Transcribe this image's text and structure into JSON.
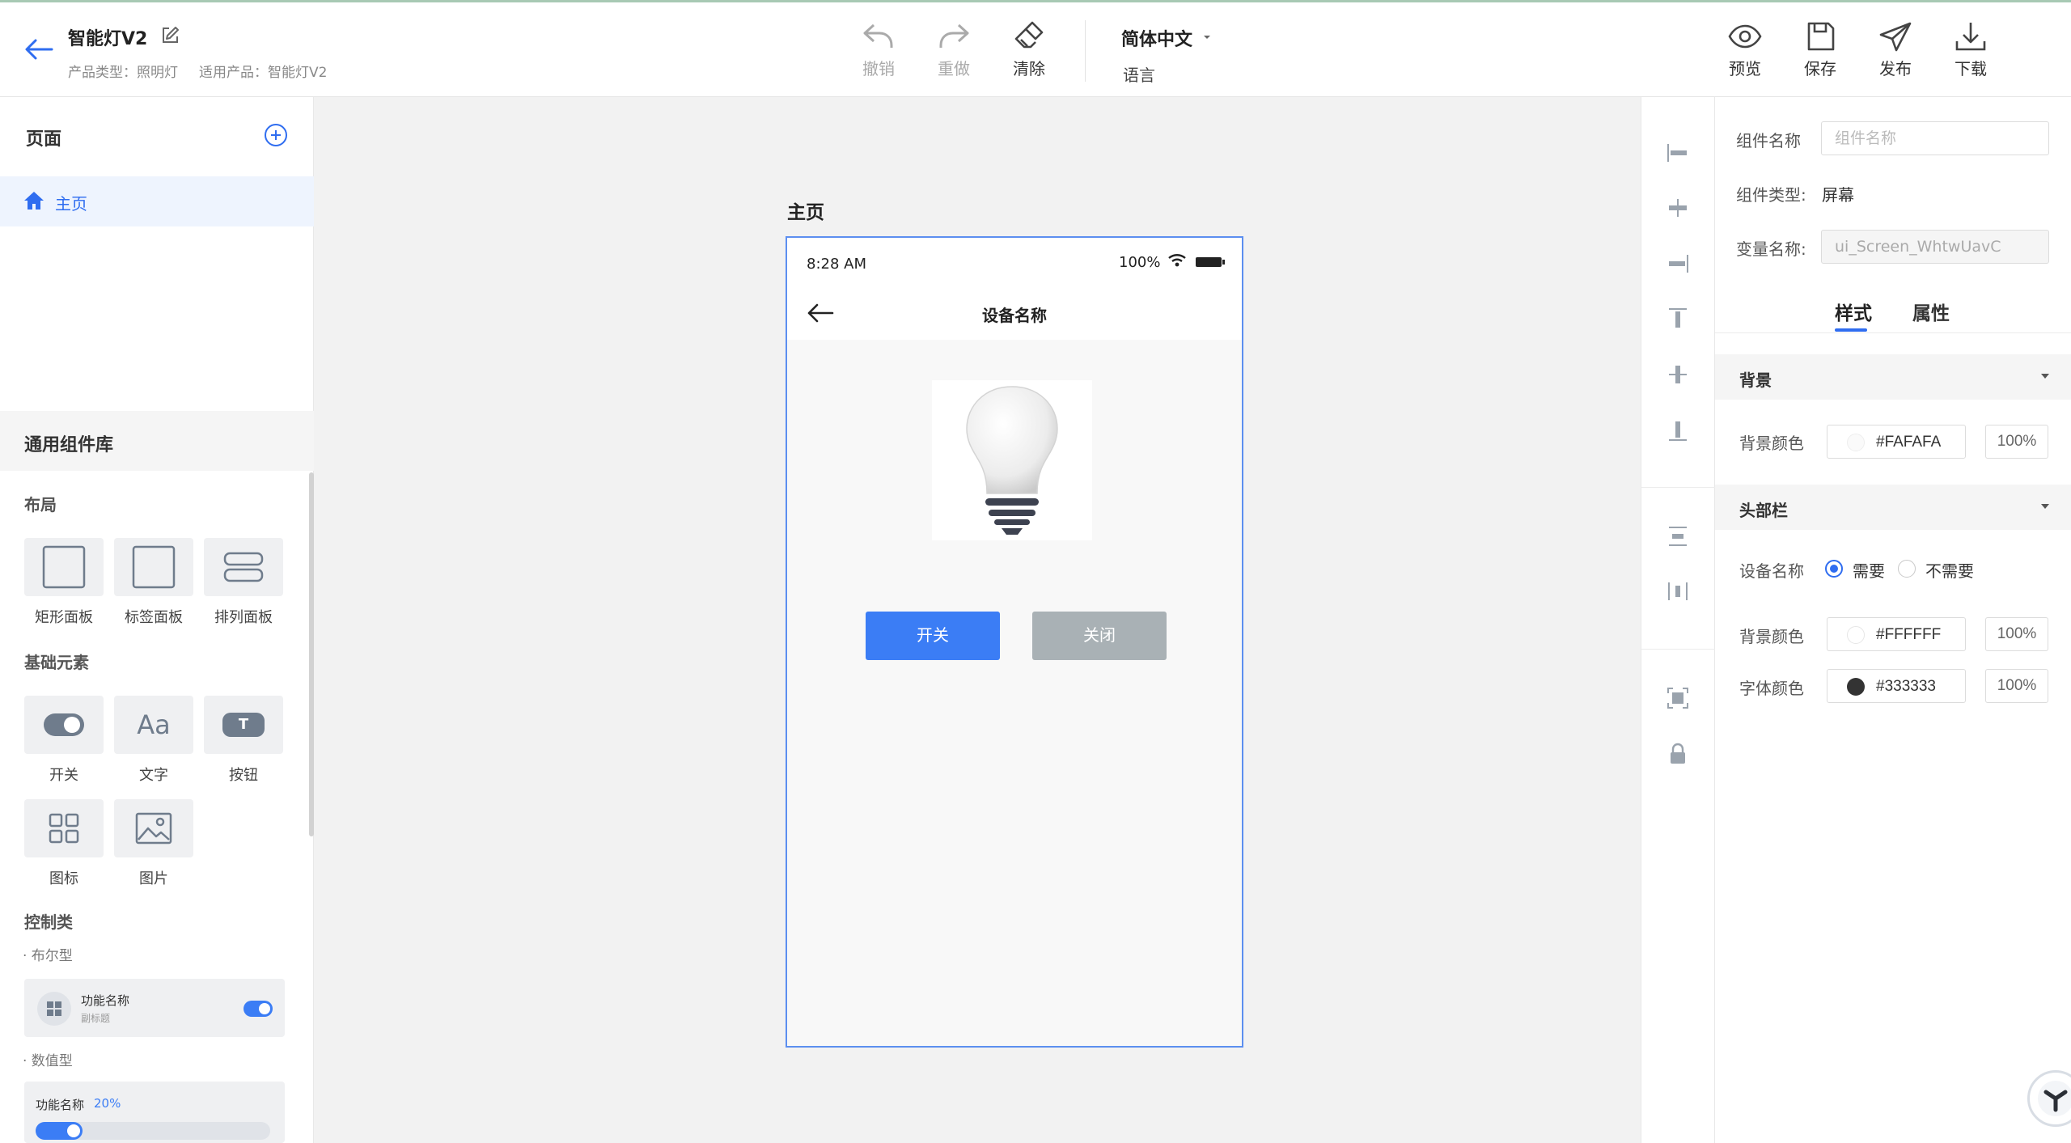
{
  "header": {
    "title": "智能灯V2",
    "meta_type": "产品类型：照明灯",
    "meta_product": "适用产品：智能灯V2",
    "toolbar": {
      "undo": "撤销",
      "redo": "重做",
      "clear": "清除"
    },
    "language": {
      "value": "简体中文",
      "label": "语言"
    },
    "actions": {
      "preview": "预览",
      "save": "保存",
      "publish": "发布",
      "download": "下载"
    }
  },
  "left_panel": {
    "pages_title": "页面",
    "pages": [
      {
        "label": "主页",
        "active": true
      }
    ],
    "library_title": "通用组件库",
    "sections": {
      "layout": "布局",
      "basic": "基础元素",
      "control": "控制类"
    },
    "layout_components": [
      "矩形面板",
      "标签面板",
      "排列面板"
    ],
    "basic_components": [
      "开关",
      "文字",
      "按钮",
      "图标",
      "图片"
    ],
    "basic_icon_text": {
      "text_glyph": "Aa",
      "button_glyph": "T"
    },
    "control_groups": {
      "bool": "· 布尔型",
      "numeric": "· 数值型"
    },
    "bool_card": {
      "name": "功能名称",
      "subtitle": "副标题"
    },
    "numeric_card": {
      "name": "功能名称",
      "value_label": "20%",
      "value": 0.2
    }
  },
  "canvas": {
    "page_title": "主页",
    "phone": {
      "time": "8:28 AM",
      "battery": "100%",
      "header_title": "设备名称",
      "btn_on": "开关",
      "btn_off": "关闭"
    }
  },
  "right_panel": {
    "component_name_label": "组件名称",
    "component_name_placeholder": "组件名称",
    "component_type_label": "组件类型:",
    "component_type_value": "屏幕",
    "var_name_label": "变量名称:",
    "var_name_value": "ui_Screen_WhtwUavC",
    "tabs": [
      "样式",
      "属性"
    ],
    "sections": {
      "background": "背景",
      "header": "头部栏"
    },
    "bg_color_label": "背景颜色",
    "bg_color": "#FAFAFA",
    "bg_opacity": "100%",
    "device_name_label": "设备名称",
    "device_name_options": [
      "需要",
      "不需要"
    ],
    "header_bg_label": "背景颜色",
    "header_bg_color": "#FFFFFF",
    "header_bg_opacity": "100%",
    "font_color_label": "字体颜色",
    "font_color": "#333333",
    "font_opacity": "100%"
  },
  "colors": {
    "accent": "#2F6DF0",
    "btn_on": "#3B7DF5",
    "btn_off": "#A9B1B5"
  }
}
